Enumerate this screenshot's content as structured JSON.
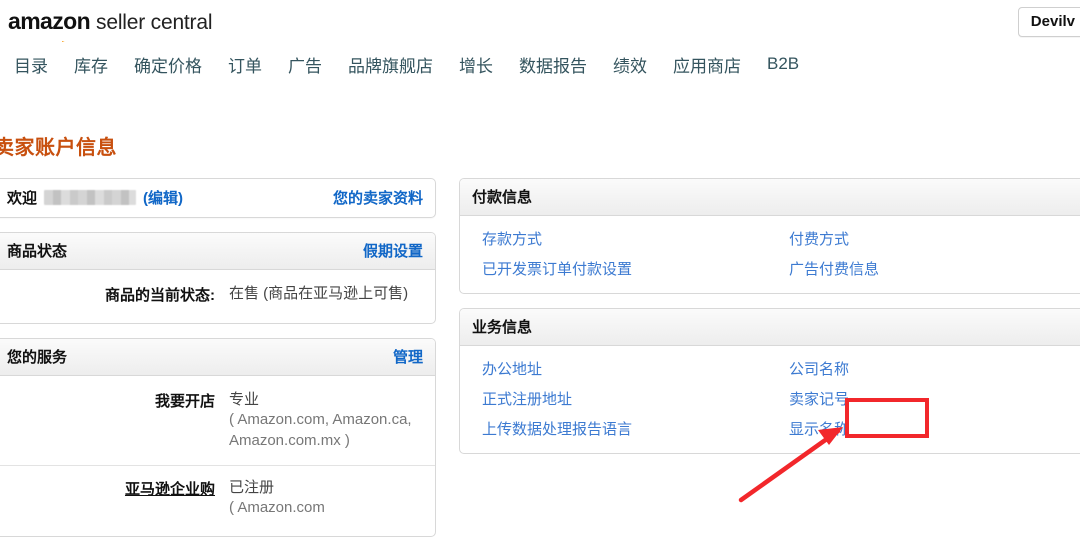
{
  "header": {
    "logo_amazon": "amazon",
    "logo_seller": "seller central",
    "account_button": "Devilv"
  },
  "nav": {
    "items": [
      {
        "label": "目录"
      },
      {
        "label": "库存"
      },
      {
        "label": "确定价格"
      },
      {
        "label": "订单"
      },
      {
        "label": "广告"
      },
      {
        "label": "品牌旗舰店"
      },
      {
        "label": "增长"
      },
      {
        "label": "数据报告"
      },
      {
        "label": "绩效"
      },
      {
        "label": "应用商店"
      },
      {
        "label": "B2B"
      }
    ]
  },
  "page_title": "卖家账户信息",
  "welcome": {
    "greeting": "欢迎",
    "name_redacted": "",
    "edit_label": "(编辑)",
    "profile_link": "您的卖家资料"
  },
  "product_status": {
    "title": "商品状态",
    "head_link": "假期设置",
    "label": "商品的当前状态:",
    "value": "在售 (商品在亚马逊上可售)"
  },
  "your_services": {
    "title": "您的服务",
    "head_link": "管理",
    "rows": [
      {
        "label": "我要开店",
        "value": "专业",
        "sub": "( Amazon.com, Amazon.ca, Amazon.com.mx )"
      },
      {
        "label": "亚马逊企业购",
        "value": "已注册",
        "sub": "( Amazon.com"
      }
    ]
  },
  "payment_info": {
    "title": "付款信息",
    "left_links": [
      {
        "label": "存款方式"
      },
      {
        "label": "已开发票订单付款设置"
      }
    ],
    "right_links": [
      {
        "label": "付费方式"
      },
      {
        "label": "广告付费信息"
      }
    ]
  },
  "business_info": {
    "title": "业务信息",
    "left_links": [
      {
        "label": "办公地址"
      },
      {
        "label": "正式注册地址"
      },
      {
        "label": "上传数据处理报告语言"
      }
    ],
    "right_links": [
      {
        "label": "公司名称"
      },
      {
        "label": "卖家记号"
      },
      {
        "label": "显示名称"
      }
    ]
  },
  "annotation": {
    "highlight_target": "公司名称",
    "color": "#F2272B"
  },
  "colors": {
    "title_orange": "#c8500f",
    "link_blue": "#3c7ad1",
    "bold_link_blue": "#1167c7",
    "nav_text": "#34545e",
    "annotation_red": "#F2272B"
  }
}
